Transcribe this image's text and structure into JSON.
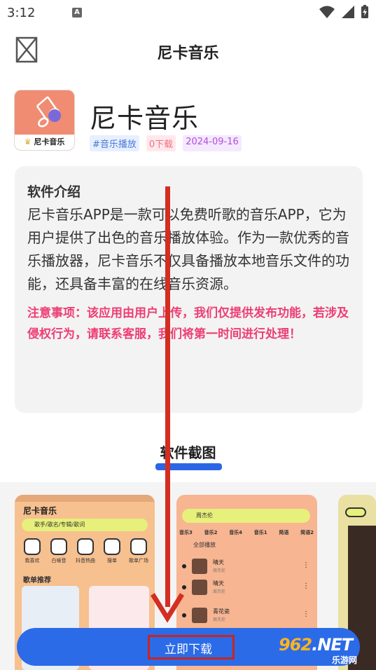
{
  "status_bar": {
    "time": "3:12",
    "notification_icon": "A"
  },
  "header": {
    "title": "尼卡音乐"
  },
  "app": {
    "name": "尼卡音乐",
    "icon_caption": "尼卡音乐",
    "tags": {
      "category": "#音乐播放",
      "downloads": "0下载",
      "date": "2024-09-16"
    }
  },
  "intro": {
    "title": "软件介绍",
    "body": "尼卡音乐APP是一款可以免费听歌的音乐APP，它为用户提供了出色的音乐播放体验。作为一款优秀的音乐播放器，尼卡音乐不仅具备播放本地音乐文件的功能，还具备丰富的在线音乐资源。",
    "notice": "注意事项：该应用由用户上传，我们仅提供发布功能，若涉及侵权行为，请联系客服，我们将第一时间进行处理！"
  },
  "screenshots": {
    "title": "软件截图",
    "shot1": {
      "title": "尼卡音乐",
      "search_placeholder": "歌手/歌名/专辑/歌词",
      "items": [
        "我喜欢",
        "白噪音",
        "抖音热曲",
        "搜单",
        "歌单广场"
      ],
      "section": "歌单推荐"
    },
    "shot2": {
      "search_text": "周杰伦",
      "tabs": [
        "音乐3",
        "音乐2",
        "音乐4",
        "音乐1",
        "简语",
        "简语2"
      ],
      "play_all": "全部播放",
      "songs": [
        {
          "name": "晴天",
          "artist": "周杰伦"
        },
        {
          "name": "晴天",
          "artist": "周杰伦"
        },
        {
          "name": "青花瓷",
          "artist": "周杰伦"
        }
      ]
    }
  },
  "download": {
    "label": "立即下载"
  },
  "watermark": {
    "main_a": "962",
    "main_b": ".NET",
    "sub": "乐游网"
  },
  "colors": {
    "accent": "#2b6be8",
    "notice": "#ee3d74",
    "arrow": "#d42d22"
  }
}
